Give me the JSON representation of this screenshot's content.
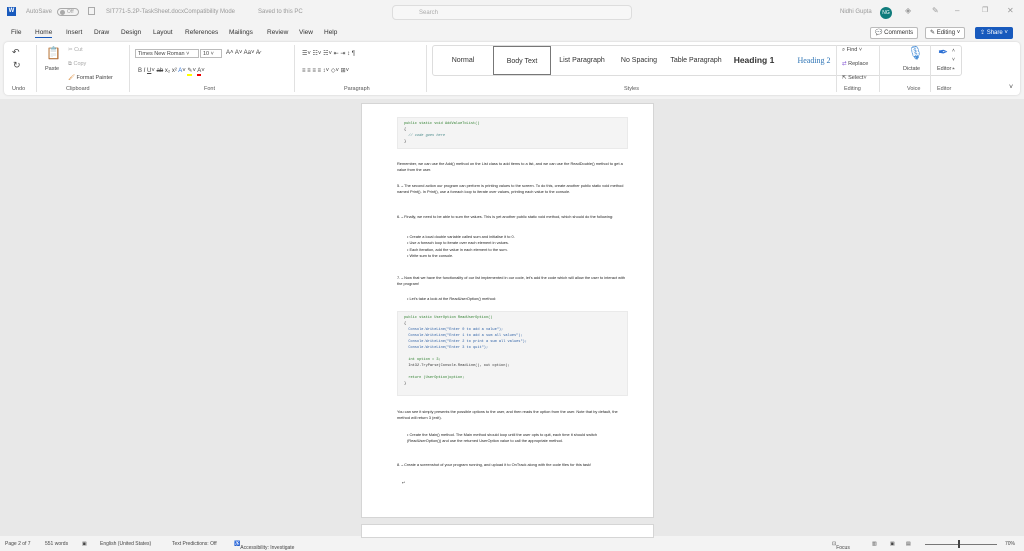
{
  "titlebar": {
    "app_icon": "W",
    "autosave": "AutoSave",
    "autosave_state": "Off",
    "filename": "SIT771-5.2P-TaskSheet.docx",
    "mode": "Compatibility Mode",
    "saved": "Saved to this PC",
    "search_placeholder": "Search",
    "user": "Nidhi Gupta",
    "initials": "NG"
  },
  "menu": [
    "File",
    "Home",
    "Insert",
    "Draw",
    "Design",
    "Layout",
    "References",
    "Mailings",
    "Review",
    "View",
    "Help"
  ],
  "top_buttons": {
    "comments": "Comments",
    "editing": "Editing",
    "share": "Share"
  },
  "ribbon": {
    "undo_group": "Undo",
    "clipboard": {
      "paste": "Paste",
      "cut": "Cut",
      "copy": "Copy",
      "format_painter": "Format Painter",
      "label": "Clipboard"
    },
    "font": {
      "name": "Times New Roman",
      "size": "10",
      "label": "Font"
    },
    "paragraph": {
      "label": "Paragraph"
    },
    "styles": {
      "items": [
        "Normal",
        "Body Text",
        "List Paragraph",
        "No Spacing",
        "Table Paragraph",
        "Heading 1",
        "Heading 2"
      ],
      "label": "Styles"
    },
    "editing": {
      "find": "Find",
      "replace": "Replace",
      "select": "Select",
      "label": "Editing"
    },
    "voice": {
      "dictate": "Dictate",
      "label": "Voice"
    },
    "editor": {
      "editor": "Editor",
      "label": "Editor"
    }
  },
  "doc": {
    "code1": [
      "public static void AddValueToList()",
      "{",
      "  // code goes here",
      "}"
    ],
    "p_remember": "Remember, we can use the Add() method on the List class to add items to a list, and we can use the ReadDouble() method to get a value from the user.",
    "p5": "5.→The second action our program can perform is printing values to the screen. To do this, create another public static void method named Print(). In Print(), use a foreach loop to iterate over values, printing each value to the console.",
    "p6": "6.→Finally, we need to be able to sum the values. This is yet another public static void method, which should do the following:",
    "bullets6": [
      "Create a local double variable called sum and initialise it to 0.",
      "Use a foreach loop to iterate over each element in values.",
      "Each iteration, add the value in each element to the sum.",
      "Write sum to the console."
    ],
    "p7": "7.→Now that we have the functionality of our list implemented in our code, let's add the code which will allow the user to interact with the program!",
    "bullet7": "Let's take a look at the ReadUserOption() method:",
    "code2": [
      "public static UserOption ReadUserOption()",
      "{",
      "  Console.WriteLine(\"Enter 0 to add a value\");",
      "  Console.WriteLine(\"Enter 1 to add a sum all values\");",
      "  Console.WriteLine(\"Enter 2 to print a sum all values\");",
      "  Console.WriteLine(\"Enter 3 to quit\");",
      "",
      "  int option = 3;",
      "  Int32.TryParse(Console.ReadLine(), out option);",
      "",
      "  return (UserOption)option;",
      "}"
    ],
    "p_see": "You can see it simply presents the possible options to the user, and then reads the option from the user. Note that by default, the method will return 3 (exit).",
    "bullet_main": "Create the Main() method. The Main method should loop until the user opts to quit, each time it should switch (ReadUserOption()) and use the returned UserOption value to call the appropriate method.",
    "p8": "8.→Create a screenshot of your program running, and upload it to OnTrack along with the code files for this task!",
    "end_mark": "↵"
  },
  "status": {
    "page": "Page 2 of 7",
    "words": "551 words",
    "language": "English (United States)",
    "predictions": "Text Predictions: Off",
    "accessibility": "Accessibility: Investigate",
    "focus": "Focus",
    "zoom": "70%"
  }
}
